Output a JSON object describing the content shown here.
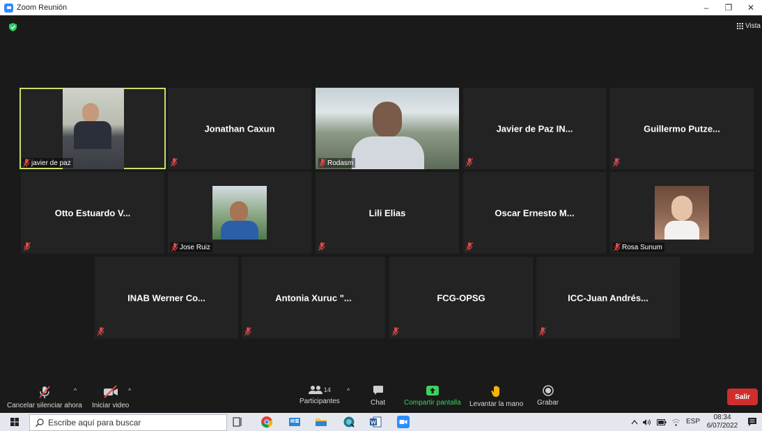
{
  "window": {
    "title": "Zoom Reunión",
    "minimize": "–",
    "restore": "❐",
    "close": "✕"
  },
  "topbar": {
    "view_label": "Vista"
  },
  "participants": [
    {
      "name": "javier de paz",
      "video": true,
      "active": true
    },
    {
      "name": "Jonathan Caxun",
      "video": false
    },
    {
      "name": "Rodasm",
      "video": true
    },
    {
      "name": "Javier de Paz IN...",
      "video": false
    },
    {
      "name": "Guillermo  Putze...",
      "video": false
    },
    {
      "name": "Otto Estuardo V...",
      "video": false
    },
    {
      "name": "Jose Ruiz",
      "video": true
    },
    {
      "name": "Lili Elias",
      "video": false
    },
    {
      "name": "Oscar Ernesto M...",
      "video": false
    },
    {
      "name": "Rosa Sunum",
      "video": true
    },
    {
      "name": "INAB Werner Co...",
      "video": false
    },
    {
      "name": "Antonia Xuruc \"...",
      "video": false
    },
    {
      "name": "FCG-OPSG",
      "video": false
    },
    {
      "name": "ICC-Juan Andrés...",
      "video": false
    }
  ],
  "toolbar": {
    "unmute_label": "Cancelar silenciar ahora",
    "video_label": "Iniciar video",
    "participants_label": "Participantes",
    "participants_count": "14",
    "chat_label": "Chat",
    "share_label": "Compartir pantalla",
    "raise_hand_label": "Levantar la mano",
    "record_label": "Grabar",
    "leave_label": "Salir"
  },
  "taskbar": {
    "search_placeholder": "Escribe aquí para buscar",
    "language": "ESP",
    "time": "08:34",
    "date": "6/07/2022"
  },
  "colors": {
    "active_speaker": "#c6e36b",
    "leave": "#d02d2d",
    "share": "#3ad35c",
    "muted_mic": "#e04848"
  }
}
